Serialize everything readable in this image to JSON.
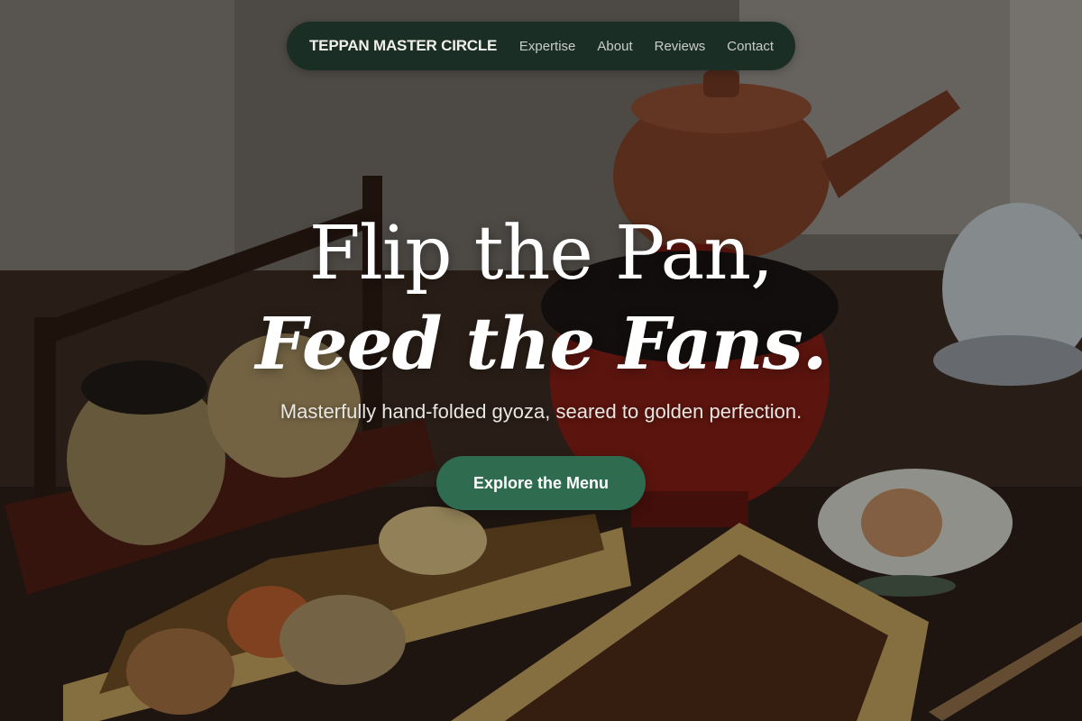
{
  "nav": {
    "brand": "TEPPAN MASTER CIRCLE",
    "links": [
      {
        "label": "Expertise"
      },
      {
        "label": "About"
      },
      {
        "label": "Reviews"
      },
      {
        "label": "Contact"
      }
    ]
  },
  "hero": {
    "headline_line1": "Flip the Pan,",
    "headline_line2": "Feed the Fans.",
    "subtitle": "Masterfully hand-folded gyoza, seared to golden perfection.",
    "cta_label": "Explore the Menu",
    "background": "japanese-meal-bento-teapot-photo"
  },
  "colors": {
    "nav_background": "#1b2e26",
    "cta_background": "#2e6b4f",
    "text_light": "#ffffff"
  }
}
